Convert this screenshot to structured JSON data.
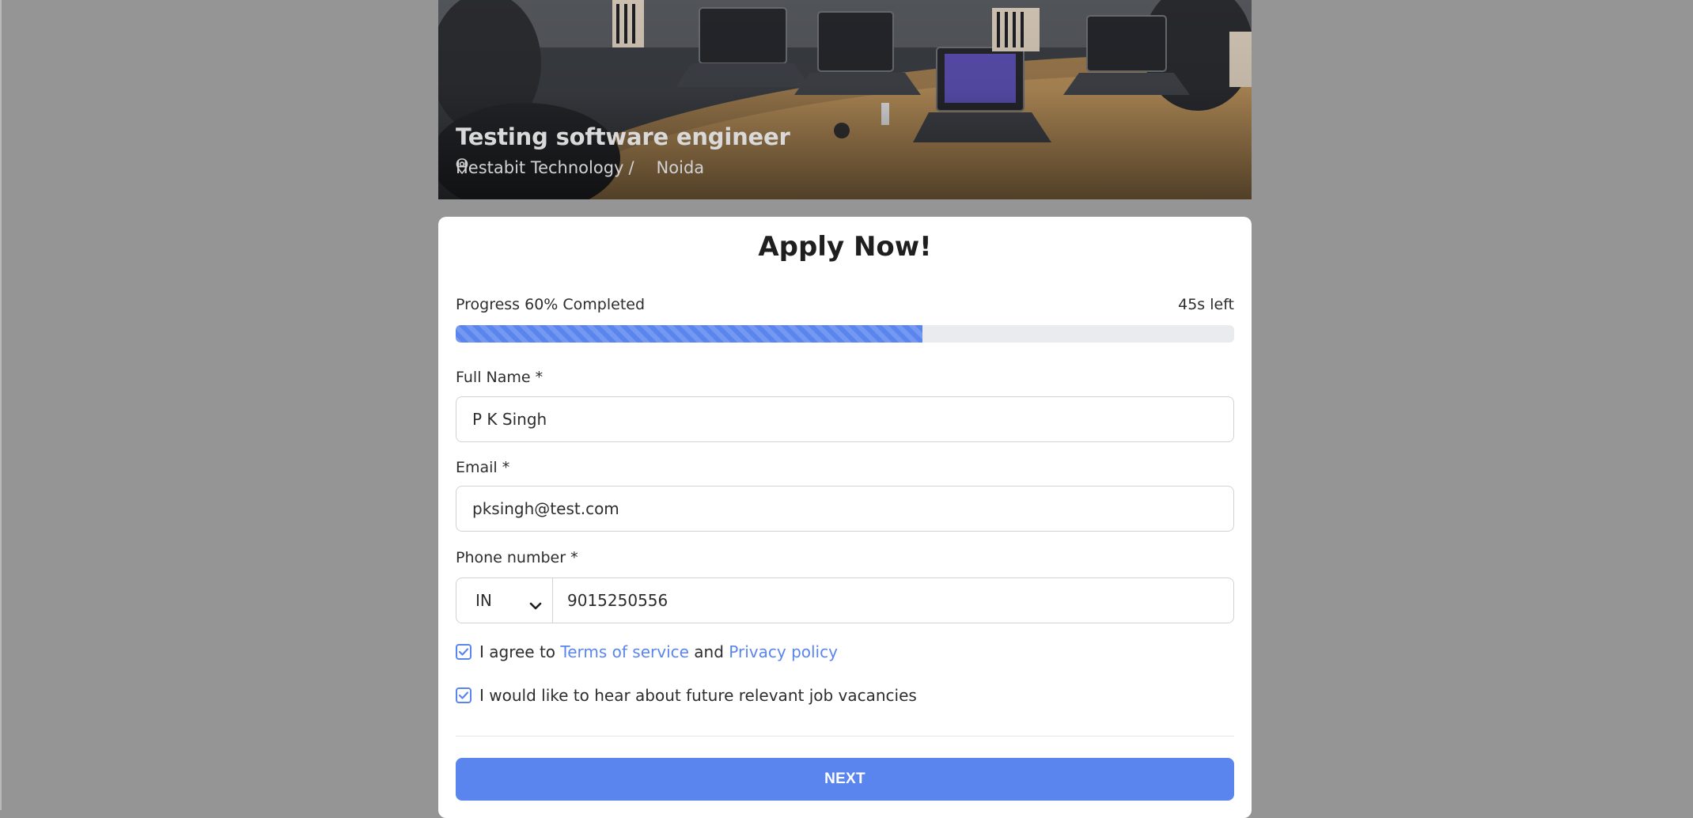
{
  "job": {
    "title": "Testing software engineer",
    "company": "Hestabit Technology",
    "separator": "/",
    "location": "Noida",
    "location_icon": "map-pin-icon"
  },
  "form": {
    "heading": "Apply Now!",
    "progress": {
      "label": "Progress 60% Completed",
      "percent": 60,
      "time_left": "45s left",
      "color": "#5b85ee"
    },
    "full_name": {
      "label": "Full Name *",
      "value": "P K Singh"
    },
    "email": {
      "label": "Email *",
      "value": "pksingh@test.com"
    },
    "phone": {
      "label": "Phone number *",
      "country_code": "IN",
      "value": "9015250556",
      "dropdown_icon": "chevron-down-icon"
    },
    "terms": {
      "checked": true,
      "prefix": "I agree to",
      "terms_link": "Terms of service",
      "conjunction": "and",
      "privacy_link": "Privacy policy"
    },
    "newsletter": {
      "checked": true,
      "label": "I would like to hear about future relevant job vacancies"
    },
    "next_label": "NEXT"
  },
  "colors": {
    "accent": "#5b85ee",
    "backdrop": "#959595"
  }
}
